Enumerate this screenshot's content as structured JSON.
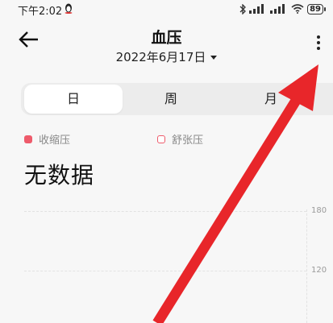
{
  "status_bar": {
    "time": "下午2:02",
    "battery": "89"
  },
  "header": {
    "title": "血压",
    "date": "2022年6月17日"
  },
  "tabs": [
    {
      "label": "日",
      "active": true
    },
    {
      "label": "周",
      "active": false
    },
    {
      "label": "月",
      "active": false
    }
  ],
  "legend": {
    "systolic": "收缩压",
    "diastolic": "舒张压"
  },
  "empty_state": "无数据",
  "chart": {
    "ticks": [
      "180",
      "120"
    ]
  },
  "colors": {
    "accent": "#ee5b6b",
    "annotation_arrow": "#e8262a"
  },
  "icons": {
    "back": "back-arrow-icon",
    "more": "more-vertical-icon",
    "date_caret": "caret-down-icon"
  }
}
